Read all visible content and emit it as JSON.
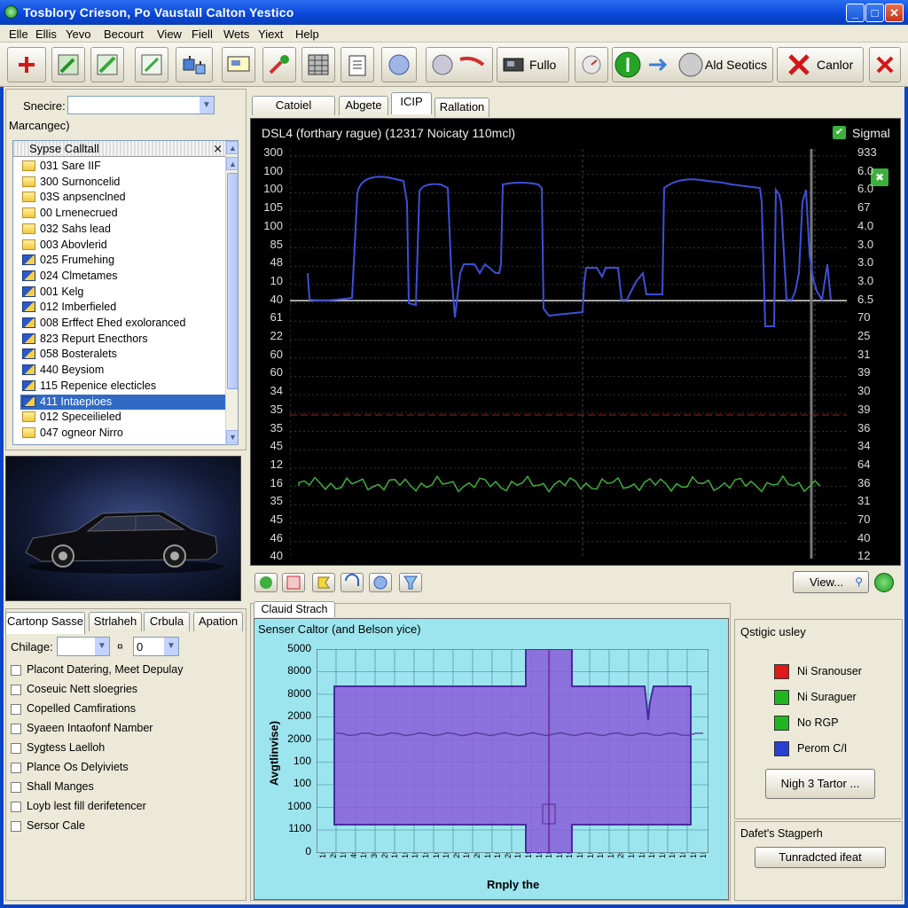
{
  "window": {
    "title": "Tosblory Crieson, Po  Vaustall Calton Yestico",
    "controls": [
      "_",
      "□",
      "✕"
    ]
  },
  "menu": [
    "Elle",
    "Ellis",
    "Yevo",
    "Becourt",
    "View",
    "Fiell",
    "Wets",
    "Yiext",
    "Help"
  ],
  "toolbar": {
    "fullo_label": "Fullo",
    "add_sections_label": "Ald Seotics",
    "cancel_label": "Canlor"
  },
  "left_panel": {
    "search_label": "Snecire:",
    "search_value": "",
    "manage_label": "Marcangec)",
    "tree_header": "Sypse Calltall",
    "tree_items": [
      {
        "label": "031 Sare IIF",
        "icon": "folder-icon"
      },
      {
        "label": "300 Surnoncelid",
        "icon": "folder-icon"
      },
      {
        "label": "03S anpsenclned",
        "icon": "folder-icon"
      },
      {
        "label": "00 Lrnenecrued",
        "icon": "folder-icon"
      },
      {
        "label": "032 Sahs lead",
        "icon": "folder-icon"
      },
      {
        "label": "003 Abovlerid",
        "icon": "folder-icon"
      },
      {
        "label": "025 Frumehing",
        "icon": "book-icon"
      },
      {
        "label": "024 Clmetames",
        "icon": "book-icon"
      },
      {
        "label": "001 Kelg",
        "icon": "book-icon"
      },
      {
        "label": "012 Imberfieled",
        "icon": "book-icon"
      },
      {
        "label": "008 Erffect Ehed exoloranced",
        "icon": "book-icon"
      },
      {
        "label": "823 Repurt Enecthors",
        "icon": "book-icon"
      },
      {
        "label": "058 Bosteralets",
        "icon": "book-icon"
      },
      {
        "label": "440 Beysiom",
        "icon": "book-icon"
      },
      {
        "label": "115 Repenice electicles",
        "icon": "book-icon"
      },
      {
        "label": "411 Intaepioes",
        "icon": "book-icon",
        "selected": true
      },
      {
        "label": "012 Speceilieled",
        "icon": "folder-icon"
      },
      {
        "label": "047 ogneor Nirro",
        "icon": "folder-icon"
      }
    ]
  },
  "scope_tabs": [
    "Catoiel Cerench",
    "Abgete",
    "ICIP",
    "Rallation"
  ],
  "scope": {
    "title": "DSL4 (forthary rague) (12317 Noicaty 110mcl)",
    "signal_label": "Sigmal",
    "left_ticks": [
      "300",
      "100",
      "100",
      "105",
      "100",
      "85",
      "48",
      "10",
      "40",
      "61",
      "22",
      "60",
      "60",
      "34",
      "35",
      "35",
      "45",
      "12",
      "16",
      "35",
      "45",
      "46",
      "40"
    ],
    "right_ticks": [
      "933",
      "6.0",
      "6.0",
      "67",
      "4.0",
      "3.0",
      "3.0",
      "3.0",
      "6.5",
      "70",
      "25",
      "31",
      "39",
      "30",
      "39",
      "36",
      "34",
      "64",
      "36",
      "31",
      "70",
      "40",
      "12"
    ],
    "view_button": "View...",
    "colors": {
      "blue_trace": "#3e4fd8",
      "green_trace": "#3fae3f",
      "red_trace": "#a02020"
    }
  },
  "option_tabs": [
    "Cartonp Sasse",
    "Strlaheh",
    "Crbula",
    "Apation"
  ],
  "options": {
    "change_label": "Chilage:",
    "change_value": "",
    "step_label": "¤",
    "step_value": "0",
    "checks": [
      "Placont Datering, Meet Depulay",
      "Coseuic Nett sloegries",
      "Copelled Camfirations",
      "Syaeen Intaofonf Namber",
      "Sygtess Laelloh",
      "Plance Os Delyiviets",
      "Shall Manges",
      "Loyb lest fill derifetencer",
      "Sersor Cale"
    ]
  },
  "bottom_chart_tab": "Clauid Strach",
  "chart_data": {
    "type": "area",
    "title": "Senser Caltor (and Belson yice)",
    "xlabel": "Rnply the",
    "ylabel": "Avgtlinvise)",
    "y_ticks": [
      "5000",
      "8000",
      "8000",
      "2000",
      "2000",
      "100",
      "100",
      "1000",
      "1100",
      "0"
    ],
    "x_ticks": [
      "1ts",
      "2ts",
      "1ts",
      "4ts",
      "1ts",
      "3ts",
      "2ts",
      "1ts",
      "1ts",
      "1ts",
      "1ts",
      "1ts",
      "1ts",
      "2ts",
      "1ts",
      "2ts",
      "1ts",
      "1ts",
      "2ts",
      "1ts",
      "1ts",
      "1ts",
      "1ts",
      "1ts",
      "1ts",
      "1ts",
      "1ts",
      "1ts",
      "1ts",
      "2ts",
      "1ts",
      "1ts",
      "1ts",
      "1ts",
      "1ts",
      "1ts",
      "1ts",
      "1ts"
    ],
    "grid": true,
    "colors": {
      "background": "#9ce5ef",
      "fill": "#8a5ed8",
      "line": "#4a2aa0"
    }
  },
  "legend_panel": {
    "title": "Qstigic usley",
    "items": [
      {
        "label": "Ni Sranouser",
        "color": "#e01818"
      },
      {
        "label": "Ni Suraguer",
        "color": "#22b522"
      },
      {
        "label": "No RGP",
        "color": "#22b522"
      },
      {
        "label": "Perom C/I",
        "color": "#2a3fd0"
      }
    ],
    "action_button": "Nigh 3 Tartor ...",
    "section2_title": "Dafet's Stagperh",
    "section2_button": "Tunradcted ifeat"
  }
}
